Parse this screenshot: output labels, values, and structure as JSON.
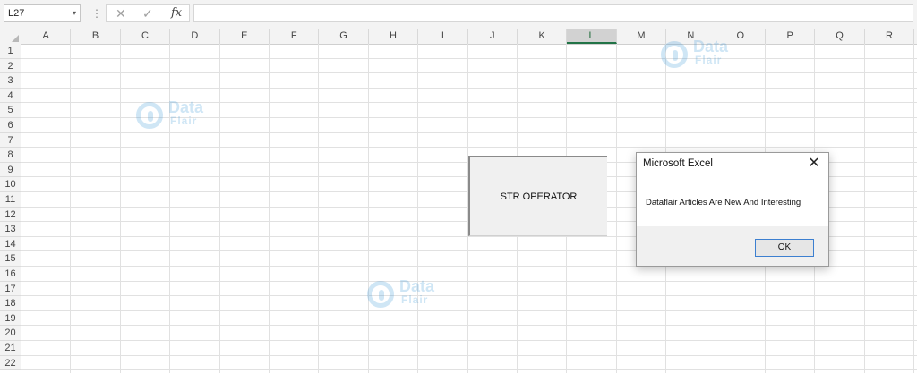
{
  "formula_bar": {
    "name_box": "L27",
    "name_box_dropdown": "▾",
    "separator": "⋮",
    "cancel_icon": "✕",
    "enter_icon": "✓",
    "fx_label": "fx",
    "formula": ""
  },
  "columns": [
    "A",
    "B",
    "C",
    "D",
    "E",
    "F",
    "G",
    "H",
    "I",
    "J",
    "K",
    "L",
    "M",
    "N",
    "O",
    "P",
    "Q",
    "R"
  ],
  "selected_column": "L",
  "rows": [
    "1",
    "2",
    "3",
    "4",
    "5",
    "6",
    "7",
    "8",
    "9",
    "10",
    "11",
    "12",
    "13",
    "14",
    "15",
    "16",
    "17",
    "18",
    "19",
    "20",
    "21",
    "22"
  ],
  "watermark": {
    "line1": "Data",
    "line2": "Flair"
  },
  "form_button": {
    "label": "STR OPERATOR"
  },
  "dialog": {
    "title": "Microsoft Excel",
    "close": "✕",
    "message": "Dataflair Articles Are New And Interesting",
    "ok_label": "OK"
  },
  "colors": {
    "accent_green": "#217346",
    "ok_border": "#3c7fd0",
    "watermark_blue": "#2a8fd6"
  }
}
